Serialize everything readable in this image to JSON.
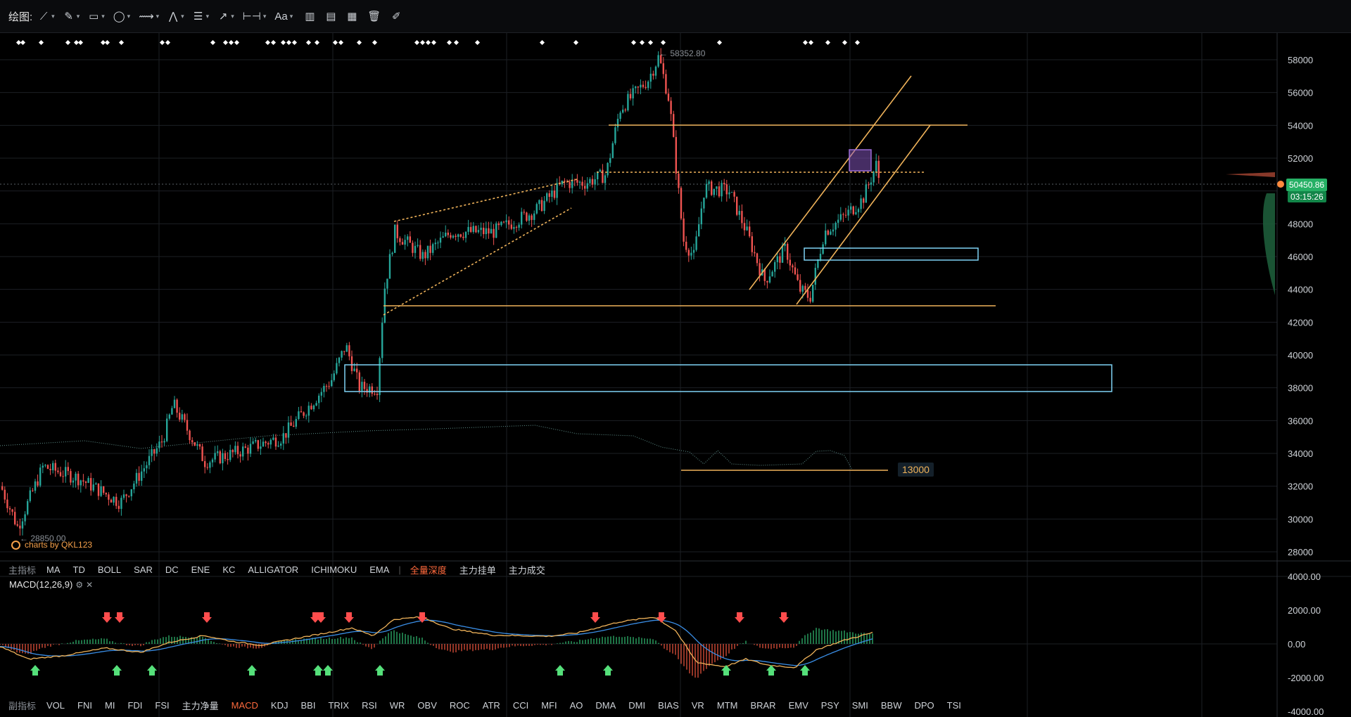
{
  "toolbar": {
    "title": "绘图:",
    "tools": [
      {
        "name": "line-tool",
        "glyph": "⟋",
        "caret": "▾"
      },
      {
        "name": "pen-tool",
        "glyph": "✎",
        "caret": "▾"
      },
      {
        "name": "rectangle-tool",
        "glyph": "▭",
        "caret": "▾"
      },
      {
        "name": "ellipse-tool",
        "glyph": "◯",
        "caret": "▾"
      },
      {
        "name": "wave-tool",
        "glyph": "⟿",
        "caret": "▾"
      },
      {
        "name": "pattern-tool",
        "glyph": "⋀",
        "caret": "▾"
      },
      {
        "name": "fib-tool",
        "glyph": "☰",
        "caret": "▾"
      },
      {
        "name": "arrow-tool",
        "glyph": "↗",
        "caret": "▾"
      },
      {
        "name": "measure-tool",
        "glyph": "⊢⊣",
        "caret": "▾"
      },
      {
        "name": "text-tool",
        "glyph": "Aa",
        "caret": "▾"
      }
    ],
    "actions": [
      {
        "name": "bars-icon",
        "glyph": "▥"
      },
      {
        "name": "chart-settings-icon",
        "glyph": "▤"
      },
      {
        "name": "indicator-icon",
        "glyph": "▦"
      },
      {
        "name": "delete-icon",
        "glyph": "🗑"
      },
      {
        "name": "brush-icon",
        "glyph": "✐"
      }
    ]
  },
  "price_axis": {
    "labels": [
      "58000",
      "56000",
      "54000",
      "52000",
      "50000",
      "48000",
      "46000",
      "44000",
      "42000",
      "40000",
      "38000",
      "36000",
      "34000",
      "32000",
      "30000",
      "28000"
    ],
    "current_price": "50450.86",
    "countdown": "03:15:26"
  },
  "macd_axis": {
    "labels": [
      "4000.00",
      "2000.00",
      "0.00",
      "-2000.00",
      "-4000.00"
    ]
  },
  "annotations": {
    "high": "← 58352.80",
    "low": "← 28850.00",
    "level": "13000",
    "watermark": "charts by QKL123"
  },
  "main_indicators": {
    "label": "主指标",
    "items": [
      "MA",
      "TD",
      "BOLL",
      "SAR",
      "DC",
      "ENE",
      "KC",
      "ALLIGATOR",
      "ICHIMOKU",
      "EMA"
    ],
    "extra": [
      "全量深度",
      "主力挂单",
      "主力成交"
    ],
    "active": "全量深度"
  },
  "macd": {
    "label": "MACD(12,26,9)",
    "settings_icon": "⚙",
    "close_icon": "✕"
  },
  "sub_indicators": {
    "label": "副指标",
    "items": [
      "VOL",
      "FNI",
      "MI",
      "FDI",
      "FSI",
      "主力净量",
      "MACD",
      "KDJ",
      "BBI",
      "TRIX",
      "RSI",
      "WR",
      "OBV",
      "ROC",
      "ATR",
      "CCI",
      "MFI",
      "AO",
      "DMA",
      "DMI",
      "BIAS",
      "VR",
      "MTM",
      "BRAR",
      "EMV",
      "PSY",
      "SMI",
      "BBW",
      "DPO",
      "TSI"
    ],
    "active": "MACD"
  },
  "colors": {
    "up": "#26a69a",
    "down": "#ef5350",
    "line": "#f0b35a",
    "box": "#7fd3f5",
    "dif": "#f0b35a",
    "dea": "#3a8ee6"
  }
}
